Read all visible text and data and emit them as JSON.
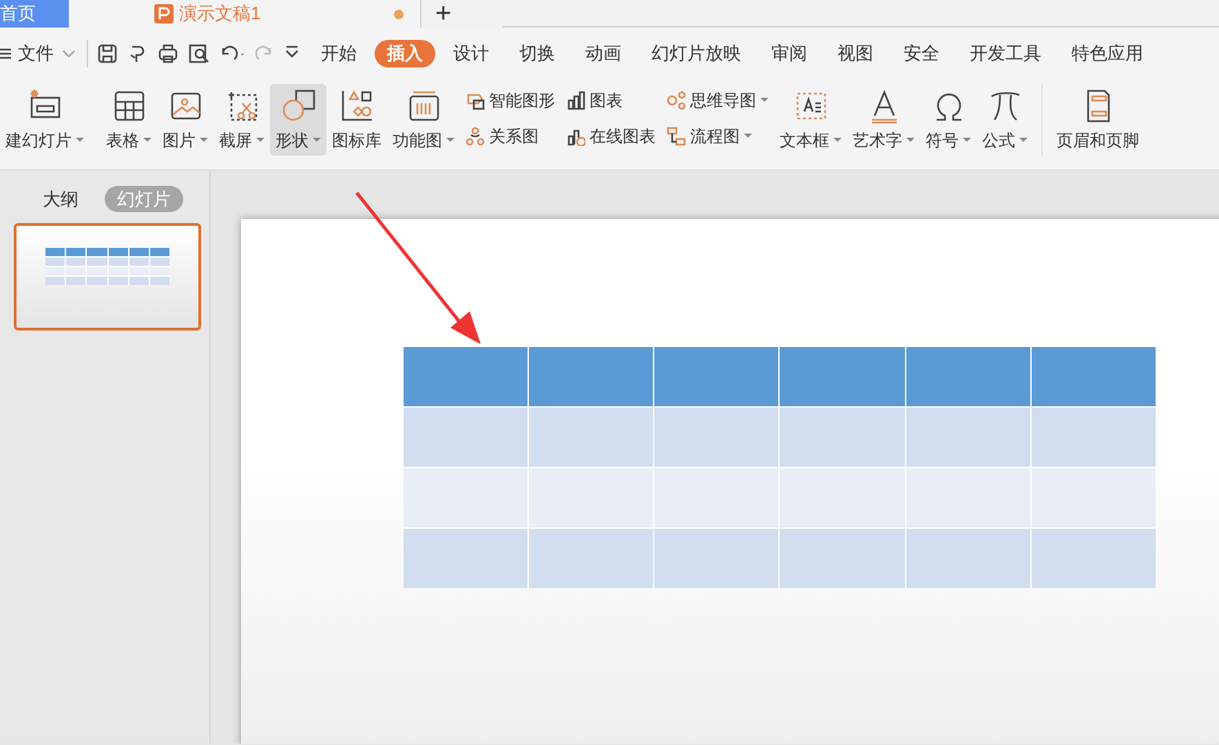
{
  "doc_tabs": [
    {
      "label": "首页",
      "kind": "home",
      "selected": false
    },
    {
      "label": "演示文稿1",
      "kind": "doc",
      "selected": true,
      "unsaved": true
    }
  ],
  "new_tab": "+",
  "file_menu": "文件",
  "menu_tabs": [
    {
      "label": "开始",
      "selected": false
    },
    {
      "label": "插入",
      "selected": true
    },
    {
      "label": "设计",
      "selected": false
    },
    {
      "label": "切换",
      "selected": false
    },
    {
      "label": "动画",
      "selected": false
    },
    {
      "label": "幻灯片放映",
      "selected": false
    },
    {
      "label": "审阅",
      "selected": false
    },
    {
      "label": "视图",
      "selected": false
    },
    {
      "label": "安全",
      "selected": false
    },
    {
      "label": "开发工具",
      "selected": false
    },
    {
      "label": "特色应用",
      "selected": false
    }
  ],
  "ribbon": [
    {
      "kind": "large",
      "label": "建幻灯片",
      "menu": true,
      "selected": false
    },
    {
      "kind": "large",
      "label": "表格",
      "menu": true,
      "selected": false
    },
    {
      "kind": "large",
      "label": "图片",
      "menu": true,
      "selected": false
    },
    {
      "kind": "large",
      "label": "截屏",
      "menu": true,
      "selected": false
    },
    {
      "kind": "large",
      "label": "形状",
      "menu": true,
      "selected": true
    },
    {
      "kind": "large",
      "label": "图标库",
      "menu": false,
      "selected": false
    },
    {
      "kind": "large",
      "label": "功能图",
      "menu": true,
      "selected": false
    },
    {
      "kind": "stack",
      "items": [
        {
          "label": "智能图形",
          "menu": false
        },
        {
          "label": "关系图",
          "menu": false
        }
      ]
    },
    {
      "kind": "stack",
      "items": [
        {
          "label": "图表",
          "menu": false
        },
        {
          "label": "在线图表",
          "menu": false
        }
      ]
    },
    {
      "kind": "stack",
      "items": [
        {
          "label": "思维导图",
          "menu": true
        },
        {
          "label": "流程图",
          "menu": true
        }
      ]
    },
    {
      "kind": "large",
      "label": "文本框",
      "menu": true,
      "selected": false
    },
    {
      "kind": "large",
      "label": "艺术字",
      "menu": true,
      "selected": false
    },
    {
      "kind": "large",
      "label": "符号",
      "menu": true,
      "selected": false
    },
    {
      "kind": "large",
      "label": "公式",
      "menu": true,
      "selected": false
    },
    {
      "kind": "large",
      "label": "页眉和页脚",
      "menu": false,
      "selected": false
    }
  ],
  "panel_tabs": [
    {
      "label": "大纲",
      "selected": false
    },
    {
      "label": "幻灯片",
      "selected": true
    }
  ],
  "slide_thumbnails": [
    {
      "selected": true
    }
  ]
}
